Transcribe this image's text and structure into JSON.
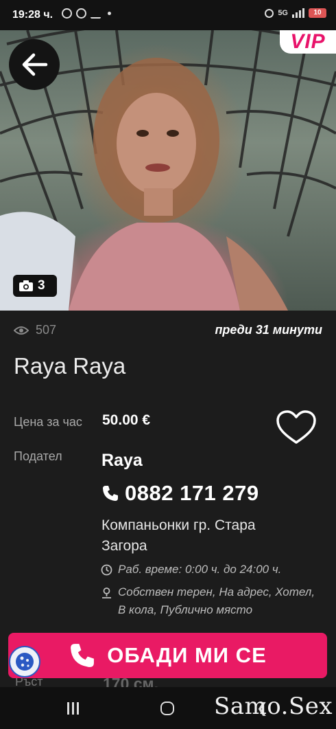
{
  "status_bar": {
    "time": "19:28 ч.",
    "network": "5G",
    "battery": "10"
  },
  "listing": {
    "vip_badge": "VIP",
    "photo_count": "3",
    "views": "507",
    "posted": "преди 31 минути",
    "title": "Raya Raya",
    "price_label": "Цена за час",
    "price_value": "50.00 €",
    "poster_label": "Подател",
    "poster_name": "Raya",
    "phone": "0882 171 279",
    "category": "Компаньонки гр. Стара Загора",
    "working_hours": "Раб. време: 0:00 ч. до 24:00 ч.",
    "locations": "Собствен терен, На адрес, Хотел, В кола, Публично място",
    "partial_label": "Ръст",
    "partial_value": "170 см."
  },
  "call_button": {
    "label": "ОБАДИ МИ СЕ"
  },
  "watermark": "Samo.Sex",
  "colors": {
    "accent": "#e91a64",
    "background": "#1c1c1c"
  }
}
